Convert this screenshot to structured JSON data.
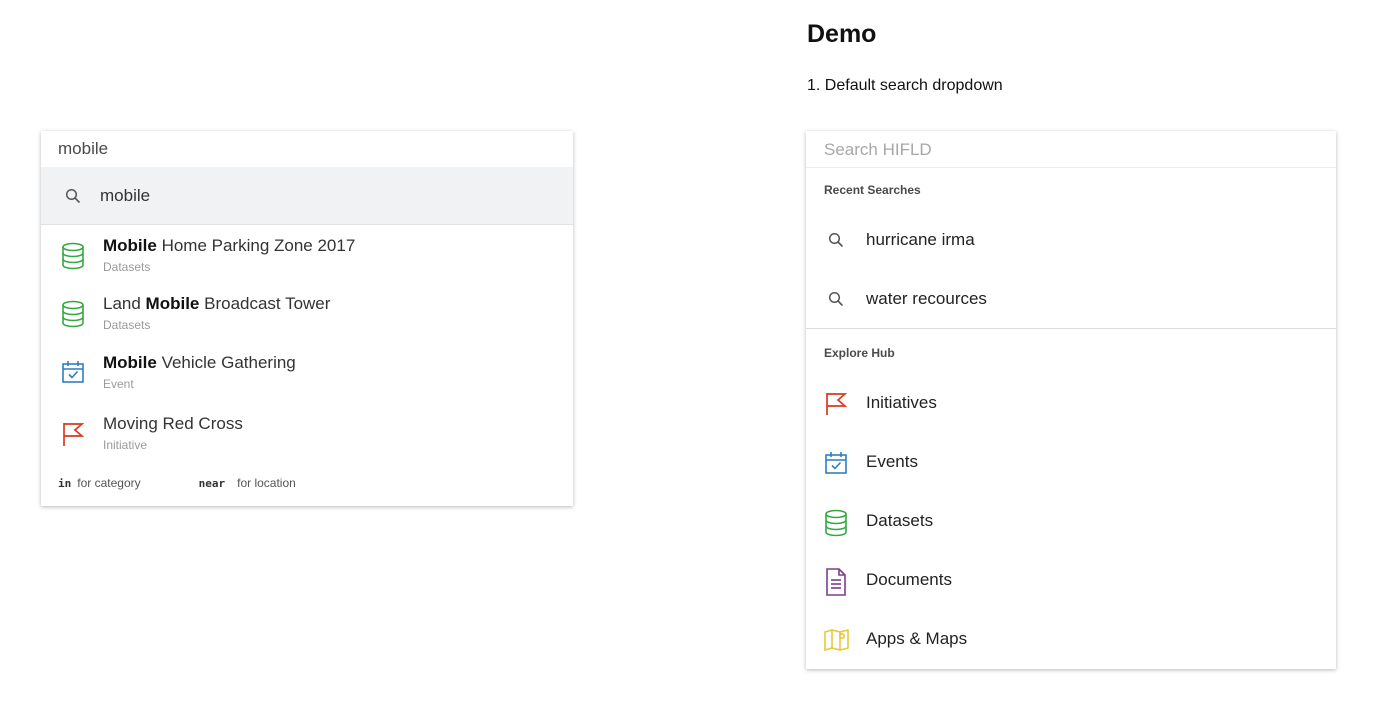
{
  "left": {
    "input_value": "mobile",
    "suggestion": "mobile",
    "results": [
      {
        "bold": "Mobile",
        "pre": "",
        "post": " Home Parking Zone 2017",
        "type": "Datasets",
        "icon": "database-icon"
      },
      {
        "bold": "Mobile",
        "pre": "Land ",
        "post": " Broadcast Tower",
        "type": "Datasets",
        "icon": "database-icon"
      },
      {
        "bold": "Mobile",
        "pre": "",
        "post": " Vehicle Gathering",
        "type": "Event",
        "icon": "calendar-check-icon"
      },
      {
        "bold": "",
        "pre": "Moving Red Cross",
        "post": "",
        "type": "Initiative",
        "icon": "flag-icon"
      }
    ],
    "hints": {
      "in_keyword": "in",
      "in_text": "for category",
      "near_keyword": "near",
      "near_text": "for location"
    }
  },
  "demo": {
    "title": "Demo",
    "subtitle": "1. Default search dropdown"
  },
  "right": {
    "placeholder": "Search HIFLD",
    "recent_label": "Recent Searches",
    "recent": [
      "hurricane irma",
      "water recources"
    ],
    "explore_label": "Explore Hub",
    "explore": [
      {
        "label": "Initiatives",
        "icon": "flag-icon"
      },
      {
        "label": "Events",
        "icon": "calendar-check-icon"
      },
      {
        "label": "Datasets",
        "icon": "database-icon"
      },
      {
        "label": "Documents",
        "icon": "document-icon"
      },
      {
        "label": "Apps & Maps",
        "icon": "map-icon"
      }
    ]
  },
  "colors": {
    "dataset_green": "#36a843",
    "event_blue": "#2d7fc1",
    "initiative_red": "#d83b1f",
    "document_purple": "#7b3e8e",
    "map_yellow": "#e8c93a"
  }
}
